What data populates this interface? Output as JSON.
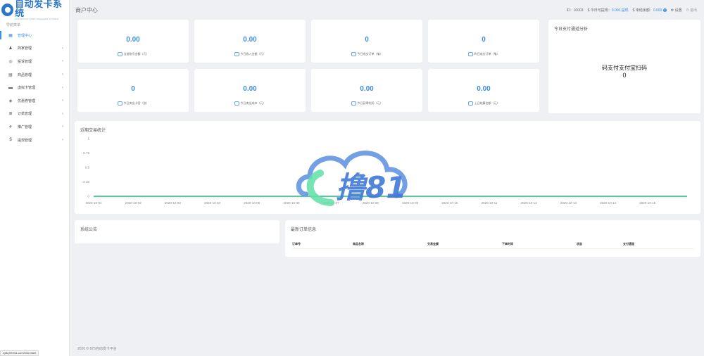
{
  "app": {
    "logo_title": "自动发卡系统",
    "logo_subtitle": "AUTOMATIC CARD ISSUANCE SYSTEM"
  },
  "sidebar": {
    "heading": "导航菜单",
    "items": [
      {
        "label": "管理中心",
        "icon": "dashboard-icon",
        "glyph": "▦",
        "active": true,
        "has_children": false
      },
      {
        "label": "商家管理",
        "icon": "user-icon",
        "glyph": "♟",
        "active": false,
        "has_children": true
      },
      {
        "label": "投诉管理",
        "icon": "complaint-icon",
        "glyph": "◎",
        "active": false,
        "has_children": true
      },
      {
        "label": "商品管理",
        "icon": "shopping-bag-icon",
        "glyph": "▤",
        "active": false,
        "has_children": true
      },
      {
        "label": "虚拟卡管理",
        "icon": "credit-card-icon",
        "glyph": "▬",
        "active": false,
        "has_children": true
      },
      {
        "label": "优惠券管理",
        "icon": "coupon-icon",
        "glyph": "◈",
        "active": false,
        "has_children": true
      },
      {
        "label": "订单管理",
        "icon": "list-icon",
        "glyph": "≣",
        "active": false,
        "has_children": true
      },
      {
        "label": "推广管理",
        "icon": "megaphone-icon",
        "glyph": "✈",
        "active": false,
        "has_children": true
      },
      {
        "label": "提现管理",
        "icon": "dollar-icon",
        "glyph": "$",
        "active": false,
        "has_children": true
      }
    ]
  },
  "header": {
    "title": "商户中心",
    "id_text": "ID：10003",
    "withdrawable_label": "$ 今日可提现：",
    "withdrawable_value": "0.000",
    "withdraw_link": "提现",
    "unsettled_label": "$ 未结余额：",
    "unsettled_value": "0.000",
    "settings_label": "设置",
    "logout_label": "退出"
  },
  "stats": [
    {
      "value": "0.00",
      "label": "当前账号金额（元）"
    },
    {
      "value": "0.00",
      "label": "今日收入金额（元）"
    },
    {
      "value": "0",
      "label": "今日成交订单（笔）"
    },
    {
      "value": "0",
      "label": "昨日成交订单（笔）"
    },
    {
      "value": "0",
      "label": "今日卖出卡密（张）"
    },
    {
      "value": "0.00",
      "label": "今日卖出成本（元）"
    },
    {
      "value": "0.00",
      "label": "今日获得利润（元）"
    },
    {
      "value": "0.00",
      "label": "上日结算金额（元）"
    }
  ],
  "pay_channel": {
    "title": "今日支付通道分析",
    "center_text": "码支付支付宝扫码",
    "center_count": "0"
  },
  "trade_chart": {
    "title": "近期交易统计"
  },
  "chart_data": {
    "type": "line",
    "title": "近期交易统计",
    "x": [
      "2020-10-01",
      "2020-10-02",
      "2020-10-03",
      "2020-10-04",
      "2020-10-05",
      "2020-10-06",
      "2020-10-07",
      "2020-10-08",
      "2020-10-09",
      "2020-10-10",
      "2020-10-11",
      "2020-10-12",
      "2020-10-13",
      "2020-10-14",
      "2020-10-15"
    ],
    "series": [
      {
        "values": [
          0,
          0,
          0,
          0,
          0,
          0,
          0,
          0,
          0,
          0,
          0,
          0,
          0,
          0,
          0
        ],
        "color": "#2fae87"
      }
    ],
    "yticks": [
      "0",
      "0.25",
      "0.5",
      "0.75",
      "1"
    ],
    "ylim": [
      0,
      1
    ],
    "grid": false
  },
  "notice": {
    "title": "系统公告"
  },
  "latest_orders": {
    "title": "最新订单信息",
    "columns": [
      "订单号",
      "商品名称",
      "交易金额",
      "下单时间",
      "状态",
      "支付通道"
    ]
  },
  "footer": {
    "text": "2020 © 875自动发卡平台"
  },
  "statusbar": {
    "url": "zyfk.jiehbs1.com/merchant"
  },
  "watermark": {
    "text": "撸81"
  },
  "colors": {
    "accent": "#3c8ee7",
    "line": "#2fae87",
    "background": "#eef0f4"
  }
}
